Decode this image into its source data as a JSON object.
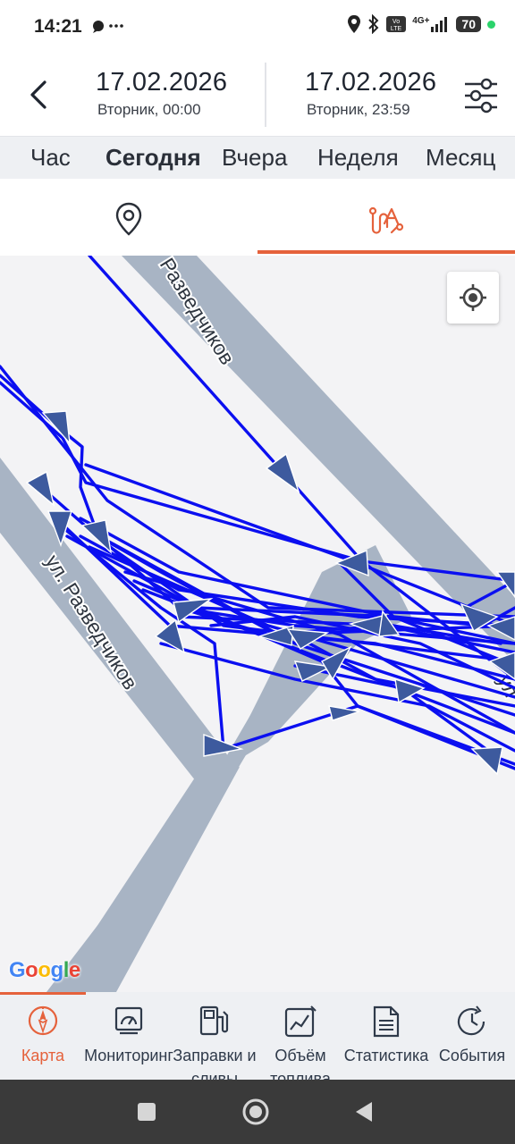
{
  "status_bar": {
    "time": "14:21",
    "notifications": "⬤ ···",
    "net": "4G+",
    "battery": "70",
    "icons": [
      "location-icon",
      "bluetooth-icon",
      "volte-icon",
      "signal-icon",
      "battery-icon"
    ]
  },
  "header": {
    "start": {
      "date": "17.02.2026",
      "sub": "Вторник, 00:00"
    },
    "end": {
      "date": "17.02.2026",
      "sub": "Вторник, 23:59"
    }
  },
  "periods": {
    "items": [
      "Час",
      "Сегодня",
      "Вчера",
      "Неделя",
      "Месяц"
    ],
    "active": "Сегодня"
  },
  "view_tabs": {
    "items": [
      "map-pin-icon",
      "route-icon"
    ],
    "active": "route-icon"
  },
  "map": {
    "streets": [
      "Разведчиков",
      "ул. Разведчиков",
      "ул"
    ],
    "attribution": "Google",
    "track_color": "#0b0ff0",
    "arrow_color": "#3d5a9e"
  },
  "bottom_nav": {
    "items": [
      {
        "label": "Карта",
        "icon": "compass-icon"
      },
      {
        "label": "Мониторинг",
        "icon": "monitoring-icon"
      },
      {
        "label": "Заправки и сливы",
        "icon": "fuel-icon"
      },
      {
        "label": "Объём топлива",
        "icon": "fuel-volume-chart-icon"
      },
      {
        "label": "Статистика",
        "icon": "statistics-icon"
      },
      {
        "label": "События",
        "icon": "events-clock-icon"
      }
    ],
    "active": "Карта"
  },
  "colors": {
    "accent": "#e5623c",
    "track": "#0b0ff0",
    "road": "#a8b4c4"
  }
}
